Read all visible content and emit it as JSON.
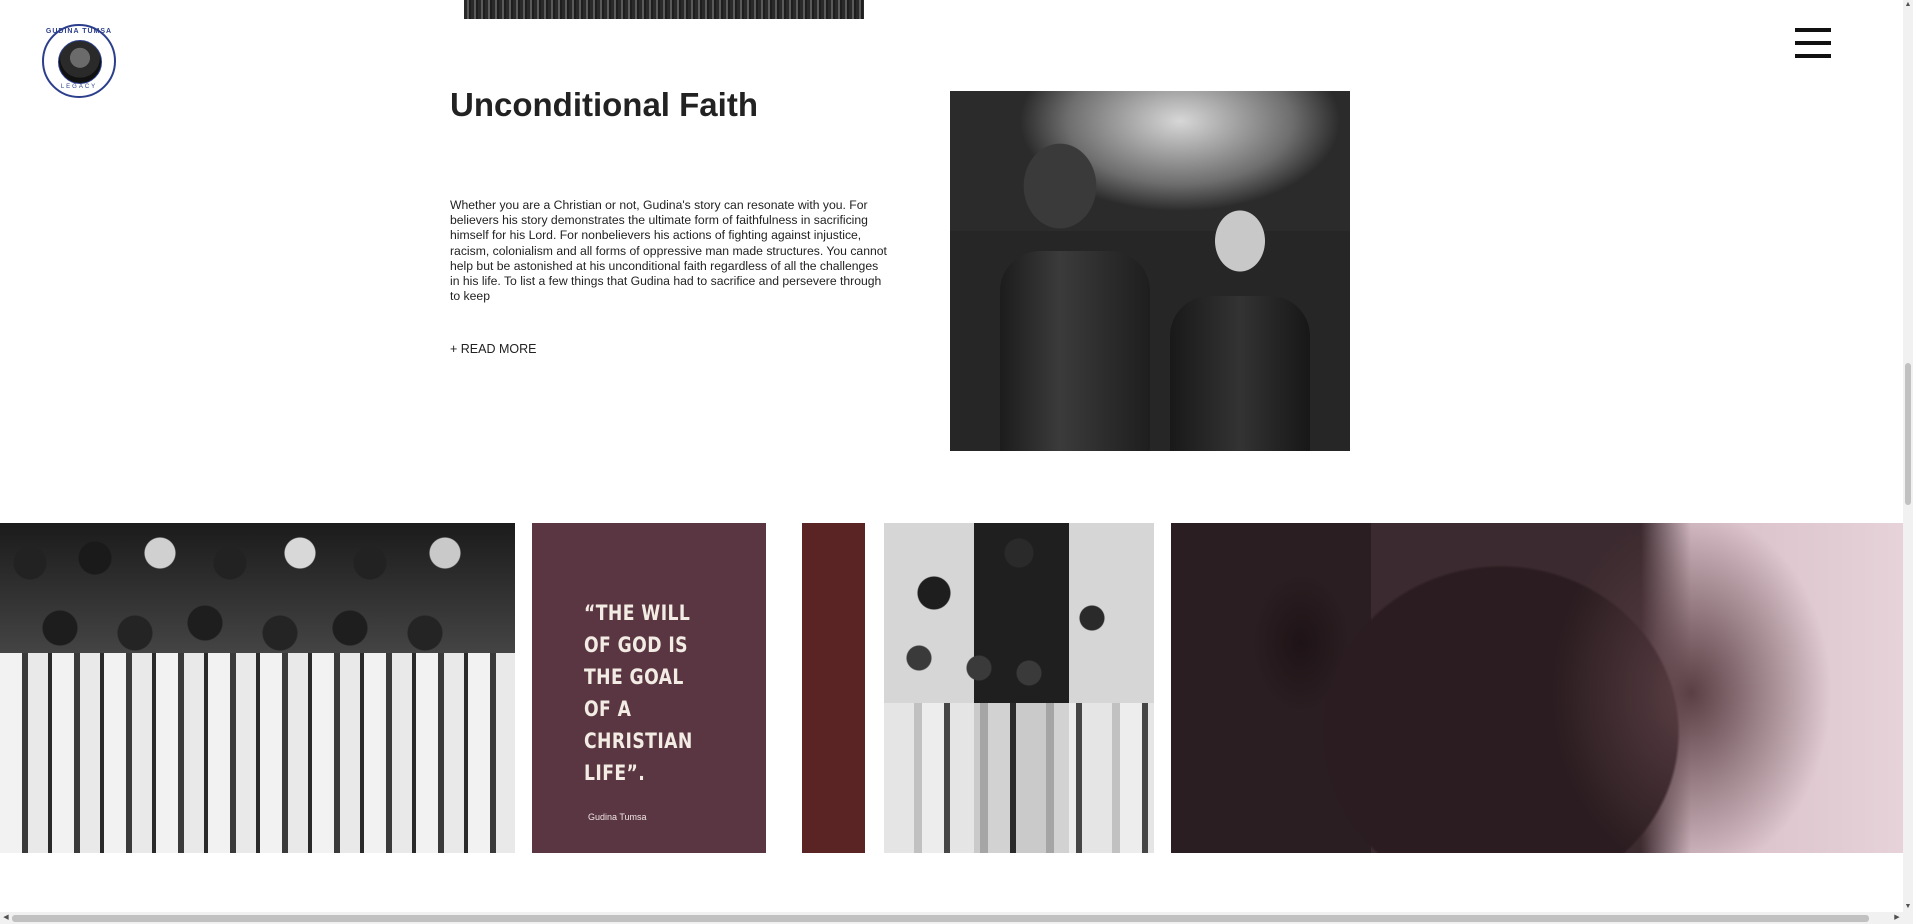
{
  "logo": {
    "arc_text_top": "GUDINA TUMSA",
    "arc_text_bottom": "LEGACY"
  },
  "section": {
    "heading": "Unconditional Faith",
    "body": "Whether you are a Christian or not, Gudina's story can resonate with you. For believers his story demonstrates the ultimate form of faithfulness in sacrificing himself for his Lord. For nonbelievers his actions of fighting against injustice, racism, colonialism and all forms of oppressive man made structures.  You cannot help but be astonished at his unconditional faith regardless of all the challenges in his life. To list a few things that Gudina had to sacrifice and persevere through to keep",
    "read_more": "+ READ MORE"
  },
  "gallery": {
    "quote": "“THE WILL OF GOD IS THE GOAL OF A CHRISTIAN LIFE”.",
    "quote_author": "Gudina Tumsa",
    "quote_bg_color": "#5a3642",
    "accent_bg_color": "#5a2424"
  },
  "icons": {
    "menu": "hamburger-icon",
    "scroll_up": "▲",
    "scroll_down": "▼",
    "scroll_left": "◀",
    "scroll_right": "▶"
  }
}
